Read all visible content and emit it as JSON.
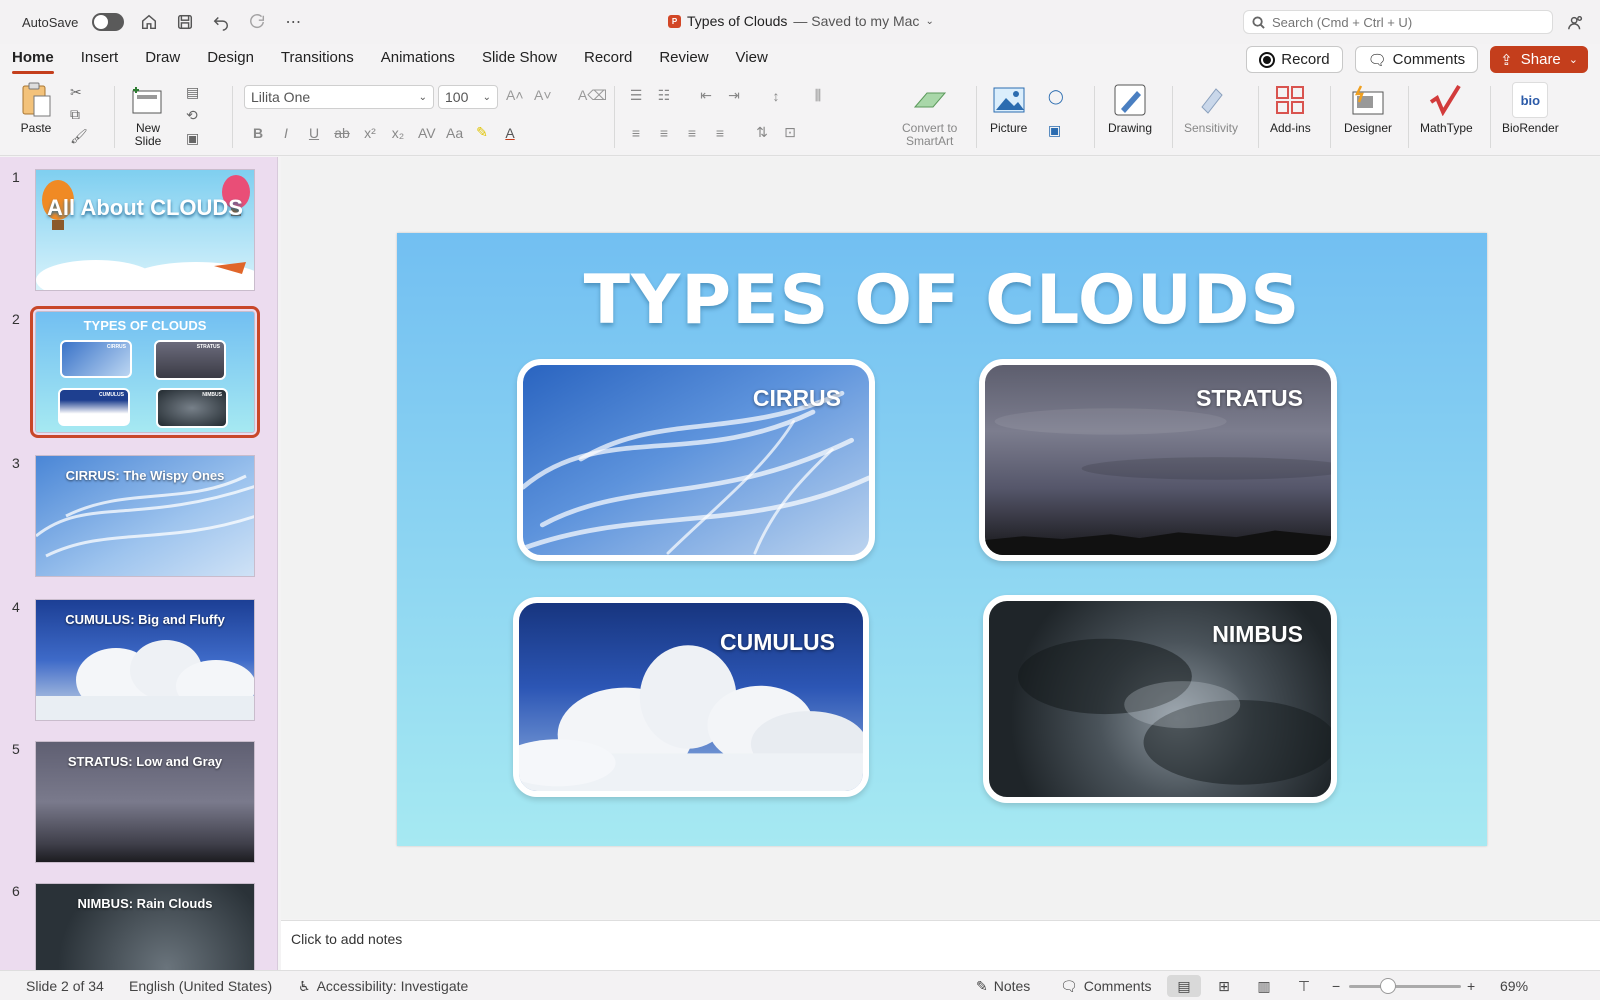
{
  "titlebar": {
    "autosave_label": "AutoSave",
    "doc_name": "Types of Clouds",
    "saved_status": "— Saved to my Mac",
    "search_placeholder": "Search (Cmd + Ctrl + U)"
  },
  "tabs": [
    "Home",
    "Insert",
    "Draw",
    "Design",
    "Transitions",
    "Animations",
    "Slide Show",
    "Record",
    "Review",
    "View"
  ],
  "tab_actions": {
    "record": "Record",
    "comments": "Comments",
    "share": "Share"
  },
  "ribbon": {
    "paste": "Paste",
    "new_slide_line1": "New",
    "new_slide_line2": "Slide",
    "font_name": "Lilita One",
    "font_size": "100",
    "convert_line1": "Convert to",
    "convert_line2": "SmartArt",
    "picture": "Picture",
    "drawing": "Drawing",
    "sensitivity": "Sensitivity",
    "addins": "Add-ins",
    "designer": "Designer",
    "mathtype": "MathType",
    "biorender": "BioRender",
    "biorender_logo": "bio"
  },
  "thumbnails": [
    {
      "num": "1",
      "title": "All About CLOUDS"
    },
    {
      "num": "2",
      "title": "TYPES OF CLOUDS"
    },
    {
      "num": "3",
      "title": "CIRRUS: The Wispy Ones"
    },
    {
      "num": "4",
      "title": "CUMULUS: Big and Fluffy"
    },
    {
      "num": "5",
      "title": "STRATUS: Low and Gray"
    },
    {
      "num": "6",
      "title": "NIMBUS: Rain Clouds"
    }
  ],
  "thumb2_labels": {
    "cirrus": "CIRRUS",
    "stratus": "STRATUS",
    "cumulus": "CUMULUS",
    "nimbus": "NIMBUS"
  },
  "slide": {
    "title": "TYPES OF CLOUDS",
    "cards": {
      "cirrus": "CIRRUS",
      "stratus": "STRATUS",
      "cumulus": "CUMULUS",
      "nimbus": "NIMBUS"
    }
  },
  "notes_placeholder": "Click to add notes",
  "status": {
    "slide_count": "Slide 2 of 34",
    "language": "English (United States)",
    "accessibility": "Accessibility: Investigate",
    "notes": "Notes",
    "comments": "Comments",
    "zoom": "69%",
    "zoom_minus": "−",
    "zoom_plus": "+"
  },
  "colors": {
    "accent": "#c43e1c",
    "slide_top": "#72bff2",
    "slide_bottom": "#a6e9f2",
    "pane": "#ecdcef"
  }
}
